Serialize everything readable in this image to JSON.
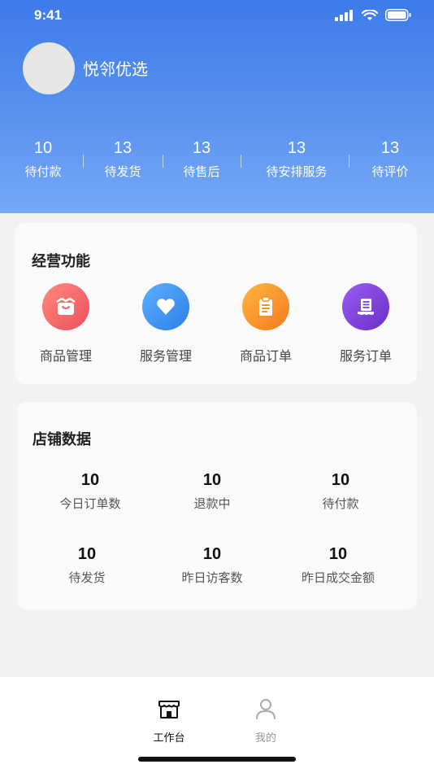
{
  "status_bar": {
    "time": "9:41"
  },
  "profile": {
    "name": "悦邻优选"
  },
  "order_stats": [
    {
      "value": "10",
      "label": "待付款"
    },
    {
      "value": "13",
      "label": "待发货"
    },
    {
      "value": "13",
      "label": "待售后"
    },
    {
      "value": "13",
      "label": "待安排服务"
    },
    {
      "value": "13",
      "label": "待评价"
    }
  ],
  "business": {
    "title": "经营功能",
    "items": [
      {
        "label": "商品管理",
        "icon": "shopping-bag-icon",
        "color": "#f56b6b"
      },
      {
        "label": "服务管理",
        "icon": "heart-icon",
        "color": "#3b8df0"
      },
      {
        "label": "商品订单",
        "icon": "clipboard-icon",
        "color": "#f7941d"
      },
      {
        "label": "服务订单",
        "icon": "service-list-icon",
        "color": "#7b3fd8"
      }
    ]
  },
  "store_data": {
    "title": "店铺数据",
    "items": [
      {
        "value": "10",
        "label": "今日订单数"
      },
      {
        "value": "10",
        "label": "退款中"
      },
      {
        "value": "10",
        "label": "待付款"
      },
      {
        "value": "10",
        "label": "待发货"
      },
      {
        "value": "10",
        "label": "昨日访客数"
      },
      {
        "value": "10",
        "label": "昨日成交金额"
      }
    ]
  },
  "tabbar": {
    "tabs": [
      {
        "label": "工作台",
        "active": true,
        "icon": "workbench-icon"
      },
      {
        "label": "我的",
        "active": false,
        "icon": "user-icon"
      }
    ]
  }
}
